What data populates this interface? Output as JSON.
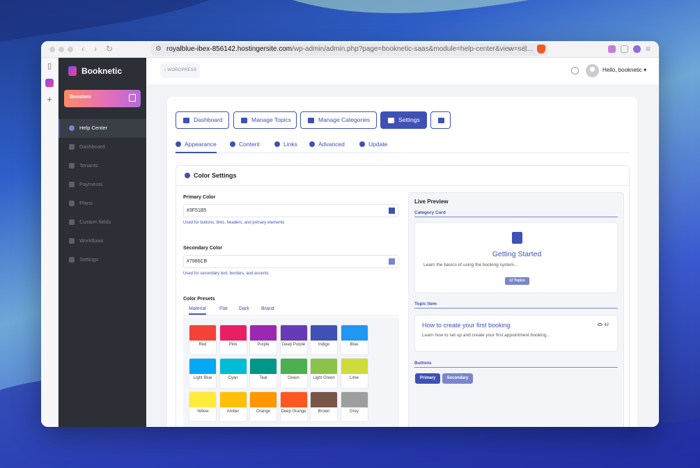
{
  "browser": {
    "url_host": "royalblue-ibex-856142.hostingersite.com",
    "url_path": "/wp-admin/admin.php?page=booknetic-saas&module=help-center&view=set..."
  },
  "sidebar": {
    "logo": "Booknetic",
    "boost_label": "Boostore",
    "items": [
      {
        "label": "Help Center",
        "icon": "question-icon",
        "active": true
      },
      {
        "label": "Dashboard",
        "icon": "dashboard-icon",
        "active": false
      },
      {
        "label": "Tenants",
        "icon": "user-icon",
        "active": false
      },
      {
        "label": "Payments",
        "icon": "card-icon",
        "active": false
      },
      {
        "label": "Plans",
        "icon": "rocket-icon",
        "active": false
      },
      {
        "label": "Custom fields",
        "icon": "wand-icon",
        "active": false
      },
      {
        "label": "Workflows",
        "icon": "workflow-icon",
        "active": false
      },
      {
        "label": "Settings",
        "icon": "gear-icon",
        "active": false
      }
    ]
  },
  "topbar": {
    "back_label": "WORDPRESS",
    "greeting": "Hello, booknetic"
  },
  "nav_buttons": [
    {
      "label": "Dashboard",
      "icon": "home-icon",
      "active": false
    },
    {
      "label": "Manage Topics",
      "icon": "file-icon",
      "active": false
    },
    {
      "label": "Manage Categories",
      "icon": "folder-icon",
      "active": false
    },
    {
      "label": "Settings",
      "icon": "gears-icon",
      "active": true
    },
    {
      "label": "",
      "icon": "archive-icon",
      "active": false
    }
  ],
  "subtabs": [
    {
      "label": "Appearance",
      "icon": "palette-icon",
      "active": true
    },
    {
      "label": "Content",
      "icon": "edit-icon",
      "active": false
    },
    {
      "label": "Links",
      "icon": "link-icon",
      "active": false
    },
    {
      "label": "Advanced",
      "icon": "gear-icon",
      "active": false
    },
    {
      "label": "Update",
      "icon": "cloud-upload-icon",
      "active": false
    }
  ],
  "color_settings": {
    "title": "Color Settings",
    "primary": {
      "label": "Primary Color",
      "value": "#3F51B5",
      "help": "Used for buttons, links, headers, and primary elements"
    },
    "secondary": {
      "label": "Secondary Color",
      "value": "#7986CB",
      "help": "Used for secondary text, borders, and accents"
    },
    "presets_label": "Color Presets",
    "preset_tabs": [
      "Material",
      "Flat",
      "Dark",
      "Brand"
    ],
    "swatches": [
      {
        "name": "Red",
        "color": "#f44336"
      },
      {
        "name": "Pink",
        "color": "#e91e63"
      },
      {
        "name": "Purple",
        "color": "#9c27b0"
      },
      {
        "name": "Deep Purple",
        "color": "#673ab7"
      },
      {
        "name": "Indigo",
        "color": "#3f51b5"
      },
      {
        "name": "Blue",
        "color": "#2196f3"
      },
      {
        "name": "Light Blue",
        "color": "#03a9f4"
      },
      {
        "name": "Cyan",
        "color": "#00bcd4"
      },
      {
        "name": "Teal",
        "color": "#009688"
      },
      {
        "name": "Green",
        "color": "#4caf50"
      },
      {
        "name": "Light Green",
        "color": "#8bc34a"
      },
      {
        "name": "Lime",
        "color": "#cddc39"
      },
      {
        "name": "Yellow",
        "color": "#ffeb3b"
      },
      {
        "name": "Amber",
        "color": "#ffc107"
      },
      {
        "name": "Orange",
        "color": "#ff9800"
      },
      {
        "name": "Deep Orange",
        "color": "#ff5722"
      },
      {
        "name": "Brown",
        "color": "#795548"
      },
      {
        "name": "Grey",
        "color": "#9e9e9e"
      }
    ]
  },
  "preview": {
    "title": "Live Preview",
    "category_section": "Category Card",
    "category_title": "Getting Started",
    "category_desc": "Learn the basics of using the booking system...",
    "category_badge": "12 Topics",
    "topic_section": "Topic Item",
    "topic_title": "How to create your first booking",
    "topic_views": "42",
    "topic_desc": "Learn how to set up and create your first appointment booking...",
    "buttons_section": "Buttons",
    "primary_button": "Primary",
    "secondary_button": "Secondary"
  },
  "colors": {
    "primary": "#3f51b5",
    "secondary": "#7986cb"
  }
}
